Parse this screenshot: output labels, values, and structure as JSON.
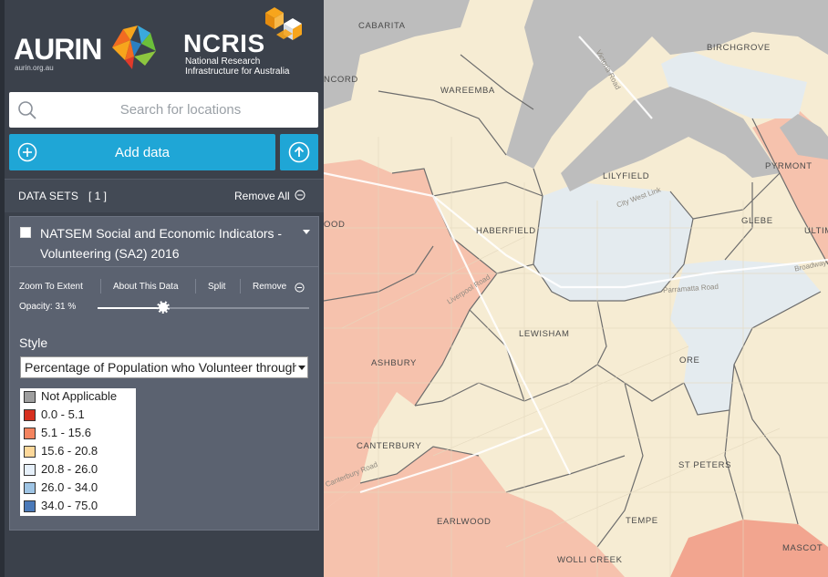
{
  "branding": {
    "aurin_name": "AURIN",
    "aurin_url": "aurin.org.au",
    "ncris_name": "NCRIS",
    "ncris_subtitle_line1": "National Research",
    "ncris_subtitle_line2": "Infrastructure for Australia"
  },
  "search": {
    "placeholder": "Search for locations",
    "value": "",
    "icon": "search-icon"
  },
  "toolbar": {
    "add_data_label": "Add data",
    "add_icon": "plus-circle-icon",
    "upload_icon": "upload-icon"
  },
  "datasets": {
    "header": "DATA SETS",
    "count": "[ 1 ]",
    "remove_all_label": "Remove All"
  },
  "layer": {
    "name": "NATSEM Social and Economic Indicators - Volunteering (SA2) 2016",
    "actions": {
      "zoom": "Zoom To Extent",
      "about": "About This Data",
      "split": "Split",
      "remove": "Remove"
    },
    "opacity_label": "Opacity: 31 %",
    "opacity_value": 0.31,
    "style_label": "Style",
    "style_selected": "Percentage of Population who Volunteer through an Organisation or Group",
    "legend": [
      {
        "label": "Not Applicable",
        "color": "#9e9e9e"
      },
      {
        "label": "0.0 - 5.1",
        "color": "#d7301f"
      },
      {
        "label": "5.1 - 15.6",
        "color": "#f4845f"
      },
      {
        "label": "15.6 - 20.8",
        "color": "#fdd89a"
      },
      {
        "label": "20.8 - 26.0",
        "color": "#e6f0fa"
      },
      {
        "label": "26.0 - 34.0",
        "color": "#9ec4e4"
      },
      {
        "label": "34.0 - 75.0",
        "color": "#4a79b8"
      }
    ]
  },
  "map": {
    "suburbs": [
      "CABARITA",
      "NCORD",
      "WAREEMBA",
      "BIRCHGROVE",
      "PYRMONT",
      "LILYFIELD",
      "GLEBE",
      "HABERFIELD",
      "ULTIM",
      "OOD",
      "LEWISHAM",
      "ASHBURY",
      "ORE",
      "CANTERBURY",
      "ST PETERS",
      "EARLWOOD",
      "TEMPE",
      "WOLLI CREEK",
      "MASCOT"
    ],
    "roads": [
      "Victoria Road",
      "Parramatta Road",
      "Liverpool Road",
      "City West Link",
      "Canterbury Road",
      "Broadway"
    ]
  }
}
